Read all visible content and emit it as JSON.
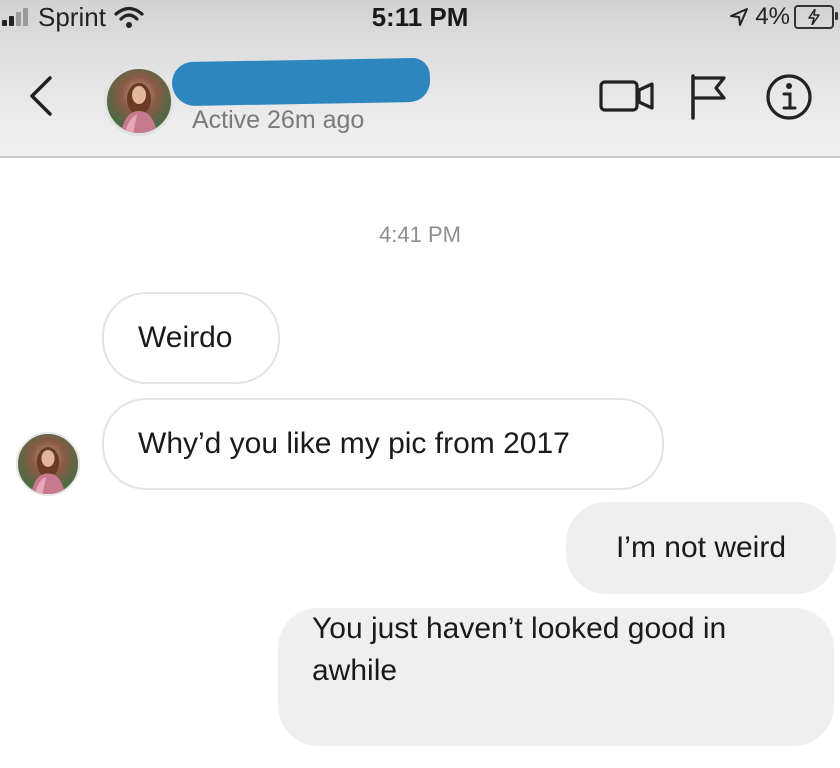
{
  "status_bar": {
    "carrier": "Sprint",
    "time": "5:11 PM",
    "battery_percent": "4%"
  },
  "header": {
    "active_status": "Active 26m ago",
    "contact_name_redacted": true
  },
  "chat": {
    "timestamp": "4:41 PM",
    "messages": [
      {
        "direction": "incoming",
        "text": "Weirdo"
      },
      {
        "direction": "incoming",
        "text": "Why’d you like my pic from 2017"
      },
      {
        "direction": "outgoing",
        "text": "I’m not weird"
      },
      {
        "direction": "outgoing",
        "text": "You just haven’t looked good in awhile"
      }
    ]
  },
  "icons": {
    "back": "chevron-left-icon",
    "video": "video-call-icon",
    "flag": "flag-icon",
    "info": "info-icon"
  }
}
